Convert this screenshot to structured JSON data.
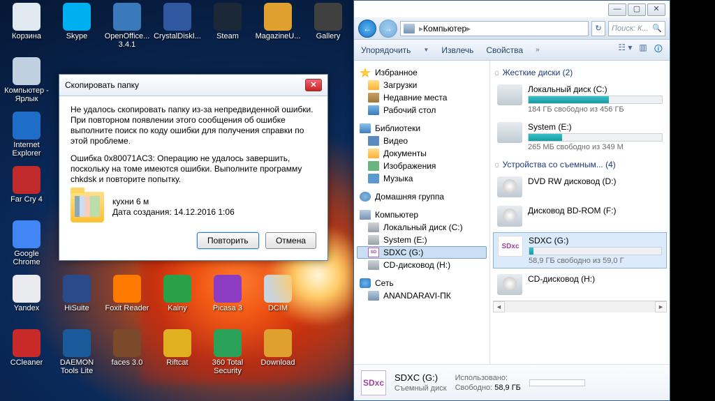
{
  "desktop_icons": [
    [
      "Корзина",
      "#e0e8f0"
    ],
    [
      "Skype",
      "#00aff0"
    ],
    [
      "OpenOffice... 3.4.1",
      "#3a7aba"
    ],
    [
      "CrystalDiskI...",
      "#3058a0"
    ],
    [
      "Steam",
      "#1b2838"
    ],
    [
      "MagazineU...",
      "#e0a030"
    ],
    [
      "Gallery",
      "#404040"
    ],
    [
      "Компьютер - Ярлык",
      "#c0d0e0"
    ],
    [
      "",
      "#"
    ],
    [
      "",
      "#"
    ],
    [
      "",
      "#"
    ],
    [
      "",
      "#"
    ],
    [
      "",
      "#"
    ],
    [
      "",
      "#"
    ],
    [
      "Internet Explorer",
      "#1e6ec8"
    ],
    [
      "",
      "#"
    ],
    [
      "",
      "#"
    ],
    [
      "",
      "#"
    ],
    [
      "",
      "#"
    ],
    [
      "",
      "#"
    ],
    [
      "",
      "#"
    ],
    [
      "Far Cry 4",
      "#c02a2a"
    ],
    [
      "",
      "#"
    ],
    [
      "",
      "#"
    ],
    [
      "",
      "#"
    ],
    [
      "",
      "#"
    ],
    [
      "",
      "#"
    ],
    [
      "",
      "#"
    ],
    [
      "Google Chrome",
      "#4285f4"
    ],
    [
      "",
      "#"
    ],
    [
      "",
      "#"
    ],
    [
      "",
      "#"
    ],
    [
      "",
      "#"
    ],
    [
      "",
      "#"
    ],
    [
      "",
      "#"
    ],
    [
      "Yandex",
      "#e8eaed"
    ],
    [
      "HiSuite",
      "#2a4a8a"
    ],
    [
      "Foxit Reader",
      "#ff7a00"
    ],
    [
      "Kainy",
      "#2aa048"
    ],
    [
      "Picasa 3",
      "#8c3cc0"
    ],
    [
      "DCIM",
      "#c8d4e0"
    ],
    [
      "",
      "#"
    ],
    [
      "CCleaner",
      "#c82a2a"
    ],
    [
      "DAEMON Tools Lite",
      "#1a5a9a"
    ],
    [
      "faces 3.0",
      "#7a4a2a"
    ],
    [
      "Riftcat",
      "#e0b020"
    ],
    [
      "360 Total Security",
      "#2aa058"
    ],
    [
      "Download",
      "#e0a030"
    ],
    [
      "",
      "#"
    ]
  ],
  "dialog": {
    "title": "Скопировать папку",
    "p1": "Не удалось скопировать папку из-за непредвиденной ошибки. При повторном появлении этого сообщения об ошибке выполните поиск по коду ошибки для получения справки по этой проблеме.",
    "p2": "Ошибка 0x80071AC3: Операцию не удалось завершить, поскольку на томе имеются ошибки. Выполните программу chkdsk и повторите попытку.",
    "folder_name": "кухни 6 м",
    "folder_date": "Дата создания: 14.12.2016 1:06",
    "retry": "Повторить",
    "cancel": "Отмена"
  },
  "explorer": {
    "breadcrumb": "Компьютер",
    "search_placeholder": "Поиск: К...",
    "toolbar": {
      "organize": "Упорядочить",
      "extract": "Извлечь",
      "props": "Свойства"
    },
    "tree": {
      "fav": "Избранное",
      "dl": "Загрузки",
      "recent": "Недавние места",
      "desk": "Рабочий стол",
      "libs": "Библиотеки",
      "vid": "Видео",
      "docs": "Документы",
      "img": "Изображения",
      "music": "Музыка",
      "home": "Домашняя группа",
      "pc": "Компьютер",
      "c": "Локальный диск (C:)",
      "e": "System (E:)",
      "g": "SDXC (G:)",
      "h": "CD-дисковод (H:)",
      "net": "Сеть",
      "peer": "ANANDARAVI-ПК"
    },
    "main": {
      "hdd_hdr": "Жесткие диски (2)",
      "c": {
        "name": "Локальный диск (C:)",
        "free": "184 ГБ свободно из 456 ГБ",
        "pct": 60
      },
      "e": {
        "name": "System (E:)",
        "free": "265 МБ свободно из 349 М",
        "pct": 25
      },
      "rem_hdr": "Устройства со съемным... (4)",
      "d": "DVD RW дисковод (D:)",
      "f": "Дисковод BD-ROM (F:)",
      "g": {
        "name": "SDXC (G:)",
        "free": "58,9 ГБ свободно из 59,0 Г",
        "pct": 3
      },
      "h": "CD-дисковод (H:)"
    },
    "details": {
      "name": "SDXC (G:)",
      "type": "Съемный диск",
      "used_k": "Использовано:",
      "free_k": "Свободно:",
      "free_v": "58,9 ГБ"
    }
  }
}
